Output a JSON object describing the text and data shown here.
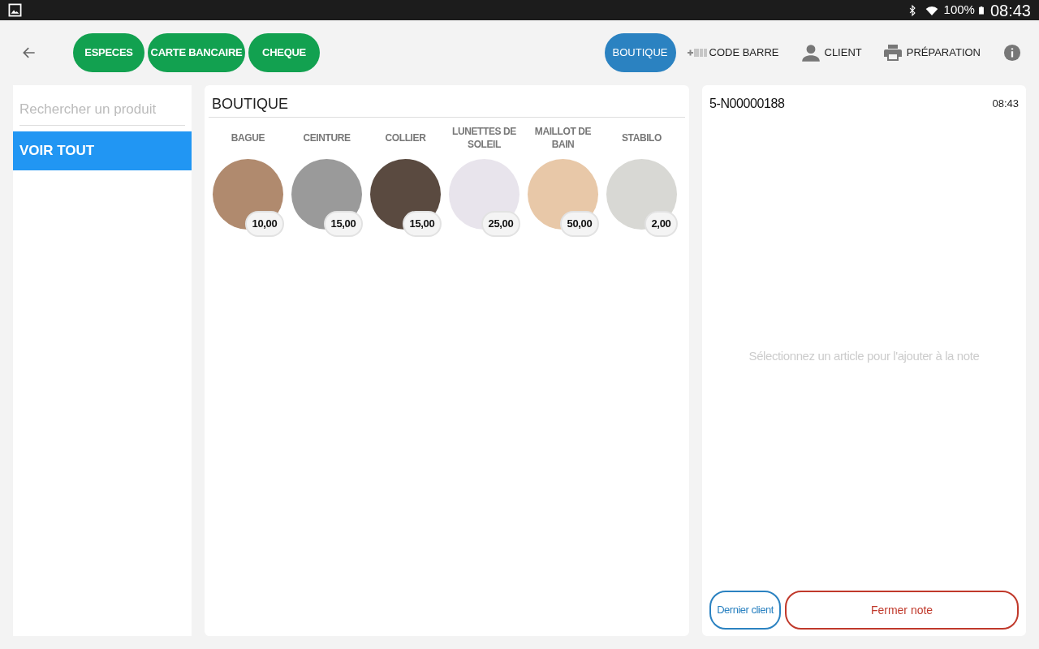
{
  "status_bar": {
    "battery": "100%",
    "time": "08:43"
  },
  "toolbar": {
    "payment_buttons": [
      "ESPECES",
      "CARTE BANCAIRE",
      "CHEQUE"
    ],
    "actions": [
      {
        "kind": "pill",
        "label": "BOUTIQUE"
      },
      {
        "kind": "barcode",
        "label": "CODE BARRE"
      },
      {
        "kind": "person",
        "label": "CLIENT"
      },
      {
        "kind": "printer",
        "label": "PRÉPARATION"
      },
      {
        "kind": "info"
      }
    ]
  },
  "sidebar": {
    "search": {
      "placeholder": "Rechercher un produit"
    },
    "items": [
      {
        "label": "VOIR TOUT",
        "selected": true
      }
    ]
  },
  "catalog": {
    "title": "BOUTIQUE",
    "products": [
      {
        "name": "BAGUE",
        "price": "10,00",
        "color": "#b08a6e"
      },
      {
        "name": "CEINTURE",
        "price": "15,00",
        "color": "#9a9a9a"
      },
      {
        "name": "COLLIER",
        "price": "15,00",
        "color": "#5a4a40"
      },
      {
        "name": "LUNETTES DE SOLEIL",
        "price": "25,00",
        "color": "#e8e4ec"
      },
      {
        "name": "MAILLOT DE BAIN",
        "price": "50,00",
        "color": "#e8c8a8"
      },
      {
        "name": "STABILO",
        "price": "2,00",
        "color": "#d8d8d4"
      }
    ]
  },
  "note": {
    "id": "5-N00000188",
    "time": "08:43",
    "empty_message": "Sélectionnez un article pour l'ajouter à la note",
    "buttons": [
      "Dernier client",
      "Fermer note"
    ]
  }
}
